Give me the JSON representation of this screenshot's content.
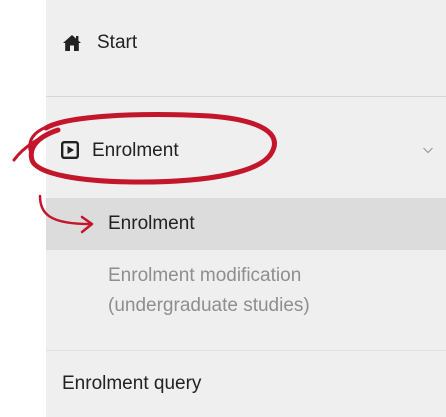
{
  "nav": {
    "start": {
      "label": "Start",
      "icon": "home-icon"
    },
    "enrolment_group": {
      "label": "Enrolment",
      "icon": "play-square-icon",
      "toggle_icon": "chevron-down-icon",
      "expanded": true
    },
    "items": [
      {
        "label": "Enrolment",
        "active": true
      },
      {
        "label_line1": "Enrolment modification",
        "label_line2": "(undergraduate studies)",
        "active": false
      }
    ],
    "query": {
      "label": "Enrolment query"
    }
  },
  "annotation": {
    "color": "#c4162a",
    "shapes": [
      "highlight-ellipse",
      "pointer-arrow"
    ]
  },
  "colors": {
    "sidebar_bg": "#efefef",
    "active_bg": "#dcdcdc",
    "muted_text": "#8e8e8e"
  }
}
